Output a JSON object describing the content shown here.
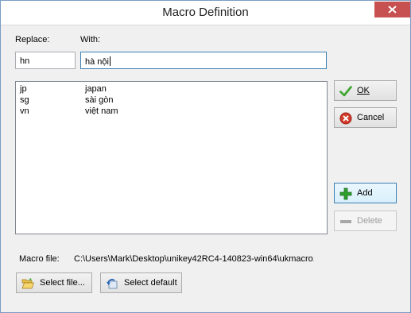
{
  "window": {
    "title": "Macro Definition"
  },
  "form": {
    "replace_label": "Replace:",
    "with_label": "With:",
    "replace_value": "hn",
    "with_value": "hà nội"
  },
  "macros": [
    {
      "key": "jp",
      "value": "japan"
    },
    {
      "key": "sg",
      "value": "sài gòn"
    },
    {
      "key": "vn",
      "value": "việt nam"
    }
  ],
  "buttons": {
    "ok": "OK",
    "cancel": "Cancel",
    "add": "Add",
    "delete": "Delete",
    "select_file": "Select file...",
    "select_default": "Select default"
  },
  "macro_file": {
    "label": "Macro file:",
    "path": "C:\\Users\\Mark\\Desktop\\unikey42RC4-140823-win64\\ukmacro.t"
  },
  "icons": {
    "ok": "check-icon",
    "cancel": "cancel-icon",
    "add": "plus-icon",
    "delete": "minus-icon",
    "select_file": "folder-open-icon",
    "select_default": "reset-icon",
    "close": "close-icon"
  },
  "colors": {
    "close_button": "#c75050",
    "ok_check": "#3aa52a",
    "cancel_red": "#d23a2a",
    "add_green": "#2e9e2e",
    "focus_border": "#3c7fb1"
  }
}
